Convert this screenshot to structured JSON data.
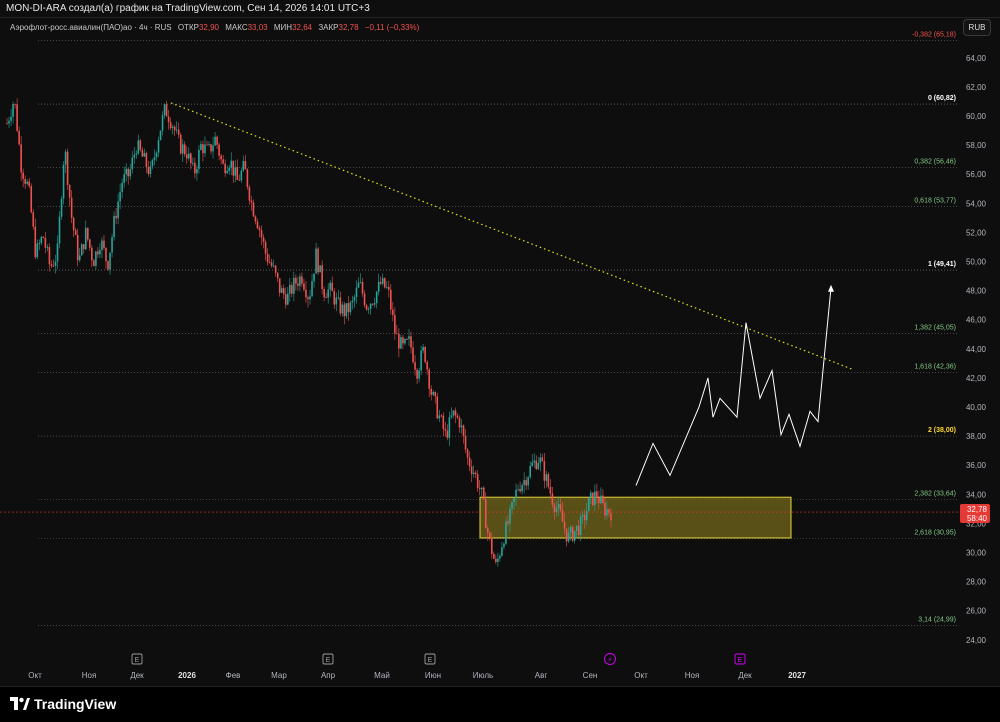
{
  "header": {
    "title": "MON-DI-ARA создал(а) график на TradingView.com, Сен 14, 2026 14:01 UTC+3"
  },
  "legend": {
    "symbol": "Аэрофлот-росс.авиалин(ПАО)ао · 4ч · RUS",
    "open_label": "ОТКР",
    "open": "32,90",
    "high_label": "МАКС",
    "high": "33,03",
    "low_label": "МИН",
    "low": "32,64",
    "close_label": "ЗАКР",
    "close": "32,78",
    "change": "−0,11 (−0,33%)"
  },
  "currency_button": "RUB",
  "footer": {
    "brand": "TradingView"
  },
  "colors": {
    "up": "#26a69a",
    "down": "#ef5350",
    "fib_line": "#5a5a5a",
    "fib_white": "#ffffff",
    "fib_green": "#81c784",
    "fib_yellow": "#fdd835",
    "fib_red": "#ef5350",
    "zone_fill": "#8a7d1c",
    "zone_border": "#e6d33a",
    "trendline": "#e6e31d",
    "projection": "#ffffff",
    "price_tag": "#e53935"
  },
  "chart_data": {
    "type": "candlestick",
    "ylim": [
      23,
      66
    ],
    "y_ticks": [
      "24,00",
      "26,00",
      "28,00",
      "30,00",
      "32,00",
      "34,00",
      "36,00",
      "38,00",
      "40,00",
      "42,00",
      "44,00",
      "46,00",
      "48,00",
      "50,00",
      "52,00",
      "54,00",
      "56,00",
      "58,00",
      "60,00",
      "62,00",
      "64,00"
    ],
    "x_labels": [
      "Окт",
      "Ноя",
      "Дек",
      "2026",
      "Фев",
      "Мар",
      "Апр",
      "Май",
      "Июн",
      "Июль",
      "Авг",
      "Сен",
      "Окт",
      "Ноя",
      "Дек",
      "2027"
    ],
    "earnings_markers": [
      "E",
      "E",
      "E",
      "E"
    ],
    "dividend_marker": "⚡",
    "last_price": "32,78",
    "countdown": "58:40",
    "price_path": [
      [
        0,
        59.5
      ],
      [
        1,
        61.2
      ],
      [
        2,
        56.5
      ],
      [
        3,
        55.0
      ],
      [
        4,
        50.5
      ],
      [
        5,
        51.8
      ],
      [
        6,
        49.6
      ],
      [
        7,
        50.5
      ],
      [
        8,
        58.0
      ],
      [
        9,
        53.0
      ],
      [
        10,
        50.0
      ],
      [
        11,
        52.0
      ],
      [
        12,
        50.0
      ],
      [
        13,
        51.5
      ],
      [
        14,
        49.8
      ],
      [
        15,
        53.0
      ],
      [
        16,
        55.5
      ],
      [
        17,
        56.0
      ],
      [
        18,
        58.0
      ],
      [
        19,
        57.0
      ],
      [
        20,
        56.0
      ],
      [
        21,
        58.5
      ],
      [
        22,
        60.5
      ],
      [
        23,
        59.5
      ],
      [
        24,
        58.0
      ],
      [
        25,
        57.5
      ],
      [
        26,
        56.0
      ],
      [
        27,
        58.0
      ],
      [
        28,
        57.5
      ],
      [
        29,
        58.5
      ],
      [
        30,
        56.5
      ],
      [
        31,
        57.0
      ],
      [
        32,
        55.5
      ],
      [
        33,
        56.5
      ],
      [
        34,
        54.0
      ],
      [
        35,
        52.5
      ],
      [
        36,
        50.5
      ],
      [
        37,
        49.5
      ],
      [
        38,
        48.0
      ],
      [
        39,
        47.5
      ],
      [
        40,
        48.5
      ],
      [
        41,
        49.0
      ],
      [
        42,
        47.5
      ],
      [
        43,
        50.5
      ],
      [
        44,
        48.0
      ],
      [
        45,
        48.0
      ],
      [
        46,
        47.0
      ],
      [
        47,
        46.5
      ],
      [
        48,
        47.0
      ],
      [
        49,
        48.5
      ],
      [
        50,
        47.0
      ],
      [
        51,
        47.5
      ],
      [
        52,
        48.5
      ],
      [
        53,
        48.0
      ],
      [
        54,
        45.0
      ],
      [
        55,
        44.0
      ],
      [
        56,
        44.5
      ],
      [
        57,
        42.5
      ],
      [
        58,
        44.0
      ],
      [
        59,
        41.0
      ],
      [
        60,
        39.5
      ],
      [
        61,
        38.0
      ],
      [
        62,
        39.5
      ],
      [
        63,
        39.0
      ],
      [
        64,
        36.5
      ],
      [
        65,
        35.5
      ],
      [
        66,
        34.0
      ],
      [
        67,
        31.0
      ],
      [
        68,
        29.0
      ],
      [
        69,
        31.0
      ],
      [
        70,
        32.5
      ],
      [
        71,
        34.5
      ],
      [
        72,
        35.0
      ],
      [
        73,
        36.0
      ],
      [
        74,
        36.5
      ],
      [
        75,
        35.0
      ],
      [
        76,
        33.5
      ],
      [
        77,
        32.5
      ],
      [
        78,
        31.0
      ],
      [
        79,
        31.5
      ],
      [
        80,
        32.0
      ],
      [
        81,
        33.5
      ],
      [
        82,
        34.0
      ],
      [
        83,
        33.0
      ],
      [
        84,
        32.8
      ]
    ],
    "fib_levels": [
      {
        "label": "-0,382 (65,18)",
        "value": 65.18
      },
      {
        "label": "0 (60,82)",
        "value": 60.82
      },
      {
        "label": "0,382 (56,46)",
        "value": 56.46
      },
      {
        "label": "0,618 (53,77)",
        "value": 53.77
      },
      {
        "label": "1 (49,41)",
        "value": 49.41
      },
      {
        "label": "1,382 (45,05)",
        "value": 45.05
      },
      {
        "label": "1,618 (42,36)",
        "value": 42.36
      },
      {
        "label": "2 (38,00)",
        "value": 38.0
      },
      {
        "label": "2,382 (33,64)",
        "value": 33.64
      },
      {
        "label": "2,618 (30,95)",
        "value": 30.95
      },
      {
        "label": "3,14 (24,99)",
        "value": 24.99
      }
    ],
    "zone": {
      "top": 33.8,
      "bottom": 31.0
    },
    "trendline": {
      "from": 60.9,
      "to": 42.6
    },
    "projection": [
      34.6,
      37.5,
      35.3,
      40.0,
      42.0,
      39.3,
      40.6,
      39.3,
      45.8,
      40.6,
      42.5,
      38.1,
      39.5,
      37.3,
      39.7,
      39.0,
      48.2
    ]
  }
}
